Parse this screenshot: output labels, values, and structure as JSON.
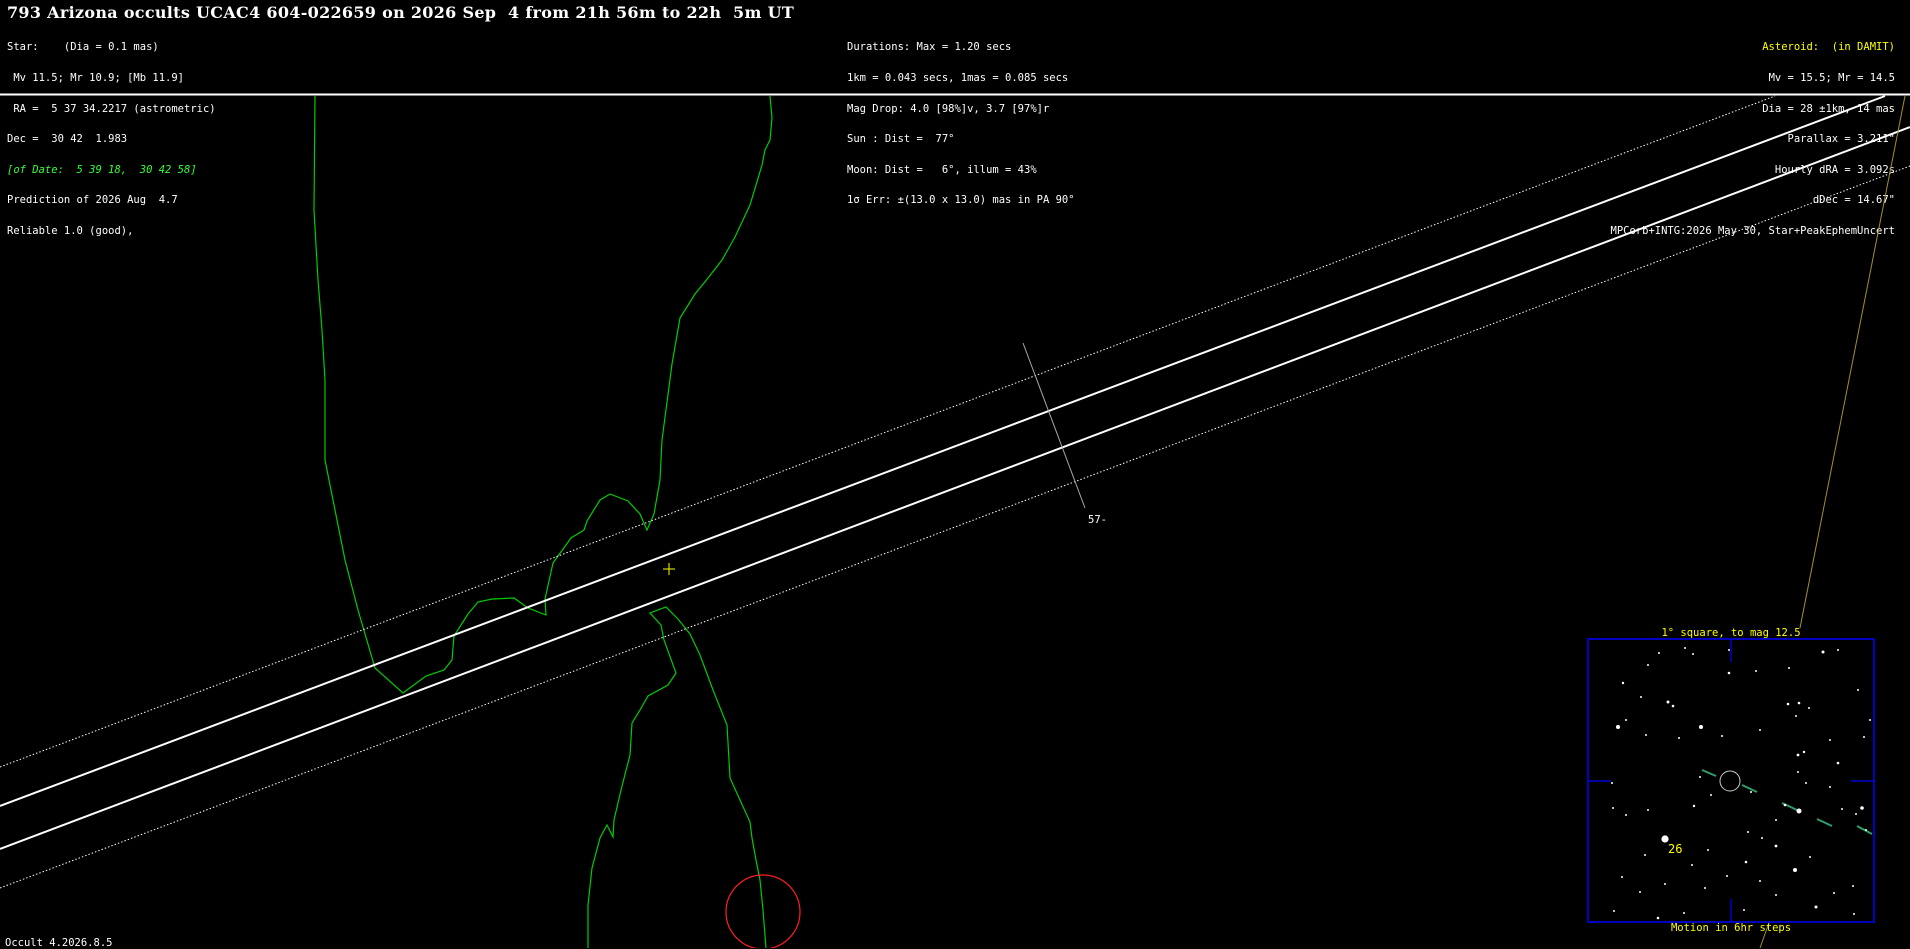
{
  "title": "793 Arizona occults UCAC4 604-022659 on 2026 Sep  4 from 21h 56m to 22h  5m UT",
  "star_block": {
    "l1": "Star:    (Dia = 0.1 mas)",
    "l2": " Mv 11.5; Mr 10.9; [Mb 11.9]",
    "l3": " RA =  5 37 34.2217 (astrometric)",
    "l4": "Dec =  30 42  1.983",
    "l5": "[of Date:  5 39 18,  30 42 58]",
    "l6": "Prediction of 2026 Aug  4.7",
    "l7": "Reliable 1.0 (good),"
  },
  "event_block": {
    "l1": "Durations: Max = 1.20 secs",
    "l2": "1km = 0.043 secs, 1mas = 0.085 secs",
    "l3": "Mag Drop: 4.0 [98%]v, 3.7 [97%]r",
    "l4": "Sun : Dist =  77°",
    "l5": "Moon: Dist =   6°, illum = 43%",
    "l6": "1σ Err: ±(13.0 x 13.0) mas in PA 90°"
  },
  "asteroid_block": {
    "l1": "Asteroid:  (in DAMIT)",
    "l2": "Mv = 15.5; Mr = 14.5",
    "l3": "Dia = 28 ±1km, 14 mas",
    "l4": "Parallax = 3.211\"",
    "l5": "Hourly dRA = 3.092s",
    "l6": "dDec = 14.67\"",
    "l7": "MPCorb+INTG:2026 May 30, Star+PeakEphemUncert"
  },
  "map": {
    "time_tick_label": "57-",
    "colors": {
      "path": "#ffffff",
      "coastline": "#00cc00",
      "moon_circle": "#ff2020",
      "center_marker": "#ffff00",
      "inset_frame": "#0000ff"
    }
  },
  "inset": {
    "title": "1° square, to mag 12.5",
    "footer": "Motion in 6hr steps",
    "star_label": "26"
  },
  "footer": {
    "version": "Occult 4.2026.8.5"
  }
}
